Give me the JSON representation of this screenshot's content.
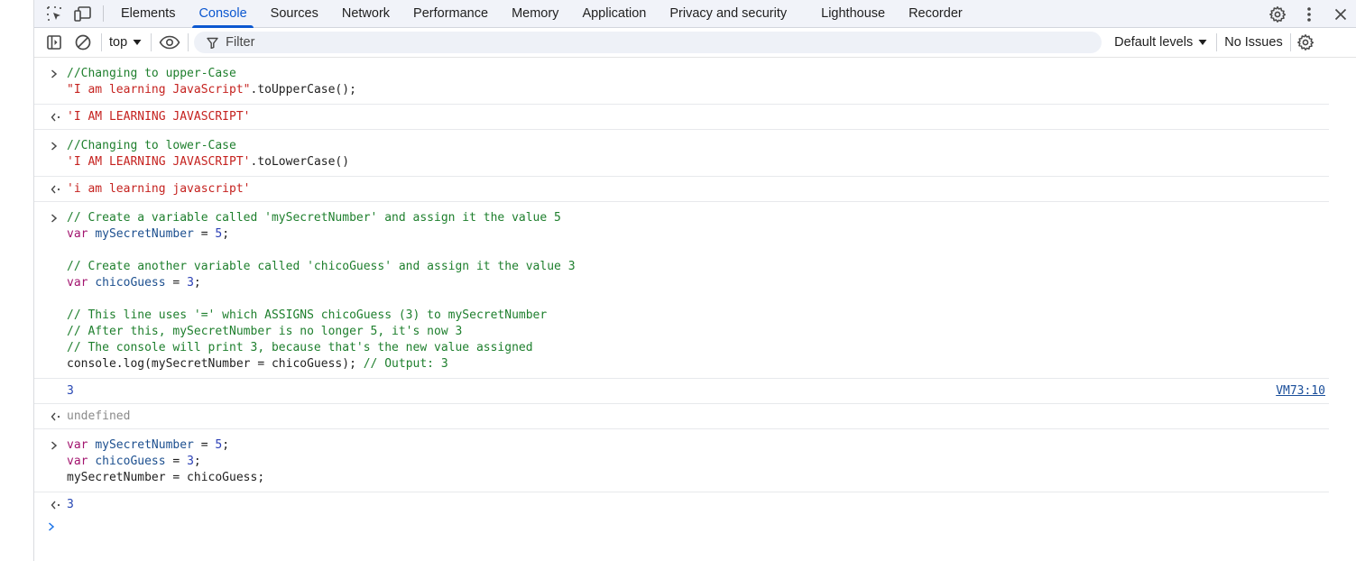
{
  "tabs": [
    "Elements",
    "Console",
    "Sources",
    "Network",
    "Performance",
    "Memory",
    "Application",
    "Privacy and security",
    "Lighthouse",
    "Recorder"
  ],
  "active_tab": "Console",
  "toolbar": {
    "context": "top",
    "filter_placeholder": "Filter",
    "levels": "Default levels",
    "issues": "No Issues"
  },
  "console": {
    "entry1": {
      "l1": "//Changing to upper-Case",
      "l2_str": "\"I am learning JavaScript\"",
      "l2_rest": ".toUpperCase();",
      "result": "'I AM LEARNING JAVASCRIPT'"
    },
    "entry2": {
      "l1": "//Changing to lower-Case",
      "l2_str": "'I AM LEARNING JAVASCRIPT'",
      "l2_rest": ".toLowerCase()",
      "result": "'i am learning javascript'"
    },
    "entry3": {
      "c1": "// Create a variable called 'mySecretNumber' and assign it the value 5",
      "kw": "var",
      "v1": "mySecretNumber",
      "eq": " = ",
      "n5": "5",
      "semi": ";",
      "c2": "// Create another variable called 'chicoGuess' and assign it the value 3",
      "v2": "chicoGuess",
      "n3": "3",
      "c3": "// This line uses '=' which ASSIGNS chicoGuess (3) to mySecretNumber",
      "c4": "// After this, mySecretNumber is no longer 5, it's now 3",
      "c5": "// The console will print 3, because that's the new value assigned",
      "log": "console.log(mySecretNumber = chicoGuess);",
      "log_cm": " // Output: 3",
      "log_out": "3",
      "log_src": "VM73:10",
      "result": "undefined"
    },
    "entry4": {
      "last": "mySecretNumber = chicoGuess;",
      "result": "3"
    }
  }
}
